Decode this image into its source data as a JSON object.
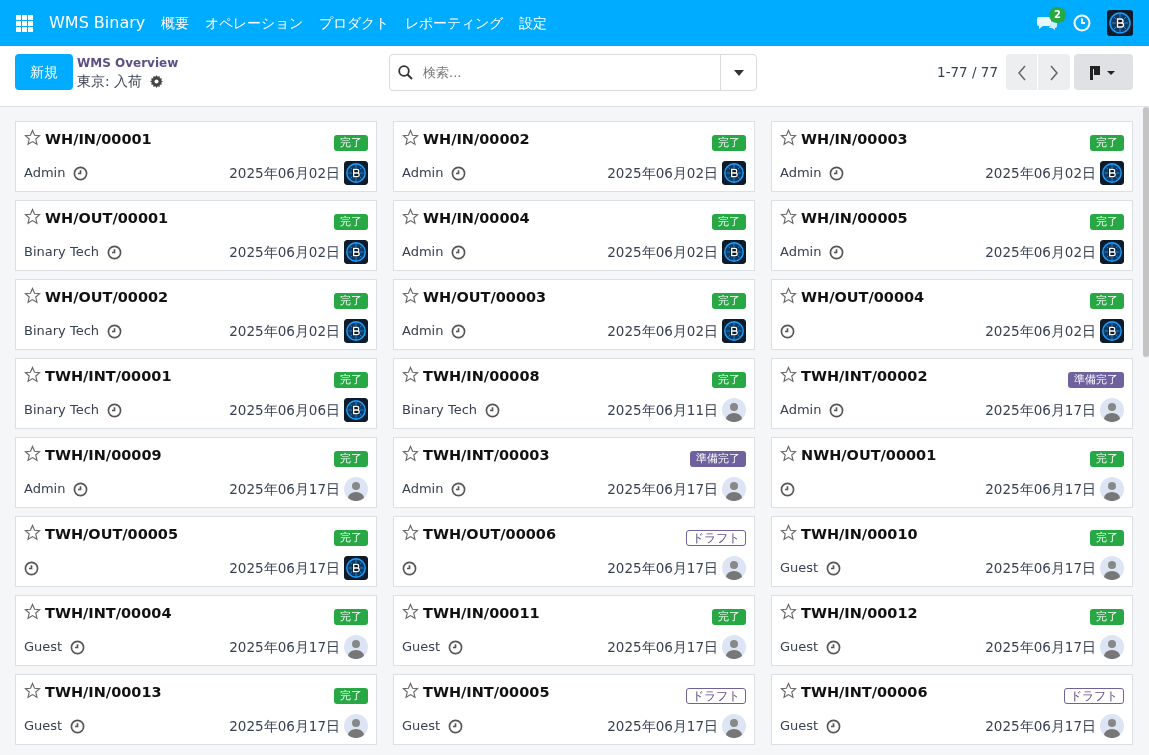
{
  "navbar": {
    "app_name": "WMS Binary",
    "menu": [
      "概要",
      "オペレーション",
      "プロダクト",
      "レポーティング",
      "設定"
    ],
    "message_count": "2"
  },
  "control_panel": {
    "new_button": "新規",
    "breadcrumb": "WMS Overview",
    "title": "東京: 入荷",
    "search": {
      "placeholder": "検索..."
    },
    "pager": "1-77 / 77"
  },
  "cards": [
    {
      "name": "WH/IN/00001",
      "status": {
        "label": "完了",
        "kind": "done"
      },
      "partner": "Admin",
      "date": "2025年06月02日",
      "avatar": {
        "kind": "logo"
      },
      "starred": false
    },
    {
      "name": "WH/IN/00002",
      "status": {
        "label": "完了",
        "kind": "done"
      },
      "partner": "Admin",
      "date": "2025年06月02日",
      "avatar": {
        "kind": "logo"
      },
      "starred": false
    },
    {
      "name": "WH/IN/00003",
      "status": {
        "label": "完了",
        "kind": "done"
      },
      "partner": "Admin",
      "date": "2025年06月02日",
      "avatar": {
        "kind": "logo"
      },
      "starred": false
    },
    {
      "name": "WH/OUT/00001",
      "status": {
        "label": "完了",
        "kind": "done"
      },
      "partner": "Binary Tech",
      "date": "2025年06月02日",
      "avatar": {
        "kind": "logo"
      },
      "starred": false
    },
    {
      "name": "WH/IN/00004",
      "status": {
        "label": "完了",
        "kind": "done"
      },
      "partner": "Admin",
      "date": "2025年06月02日",
      "avatar": {
        "kind": "logo"
      },
      "starred": false
    },
    {
      "name": "WH/IN/00005",
      "status": {
        "label": "完了",
        "kind": "done"
      },
      "partner": "Admin",
      "date": "2025年06月02日",
      "avatar": {
        "kind": "logo"
      },
      "starred": false
    },
    {
      "name": "WH/OUT/00002",
      "status": {
        "label": "完了",
        "kind": "done"
      },
      "partner": "Binary Tech",
      "date": "2025年06月02日",
      "avatar": {
        "kind": "logo"
      },
      "starred": false
    },
    {
      "name": "WH/OUT/00003",
      "status": {
        "label": "完了",
        "kind": "done"
      },
      "partner": "Admin",
      "date": "2025年06月02日",
      "avatar": {
        "kind": "logo"
      },
      "starred": false
    },
    {
      "name": "WH/OUT/00004",
      "status": {
        "label": "完了",
        "kind": "done"
      },
      "date": "2025年06月02日",
      "avatar": {
        "kind": "logo"
      },
      "starred": false
    },
    {
      "name": "TWH/INT/00001",
      "status": {
        "label": "完了",
        "kind": "done"
      },
      "partner": "Binary Tech",
      "date": "2025年06月06日",
      "avatar": {
        "kind": "logo"
      },
      "starred": false
    },
    {
      "name": "TWH/IN/00008",
      "status": {
        "label": "完了",
        "kind": "done"
      },
      "partner": "Binary Tech",
      "date": "2025年06月11日",
      "avatar": {
        "kind": "person"
      },
      "starred": false
    },
    {
      "name": "TWH/INT/00002",
      "status": {
        "label": "準備完了",
        "kind": "ready"
      },
      "partner": "Admin",
      "date": "2025年06月17日",
      "avatar": {
        "kind": "person"
      },
      "starred": false
    },
    {
      "name": "TWH/IN/00009",
      "status": {
        "label": "完了",
        "kind": "done"
      },
      "partner": "Admin",
      "date": "2025年06月17日",
      "avatar": {
        "kind": "person"
      },
      "starred": false
    },
    {
      "name": "TWH/INT/00003",
      "status": {
        "label": "準備完了",
        "kind": "ready"
      },
      "partner": "Admin",
      "date": "2025年06月17日",
      "avatar": {
        "kind": "person"
      },
      "starred": false
    },
    {
      "name": "NWH/OUT/00001",
      "status": {
        "label": "完了",
        "kind": "done"
      },
      "date": "2025年06月17日",
      "avatar": {
        "kind": "person"
      },
      "starred": false
    },
    {
      "name": "TWH/OUT/00005",
      "status": {
        "label": "完了",
        "kind": "done"
      },
      "date": "2025年06月17日",
      "avatar": {
        "kind": "logo"
      },
      "starred": false
    },
    {
      "name": "TWH/OUT/00006",
      "status": {
        "label": "ドラフト",
        "kind": "draft"
      },
      "date": "2025年06月17日",
      "avatar": {
        "kind": "person"
      },
      "starred": false
    },
    {
      "name": "TWH/IN/00010",
      "status": {
        "label": "完了",
        "kind": "done"
      },
      "partner": "Guest",
      "date": "2025年06月17日",
      "avatar": {
        "kind": "person"
      },
      "starred": false
    },
    {
      "name": "TWH/INT/00004",
      "status": {
        "label": "完了",
        "kind": "done"
      },
      "partner": "Guest",
      "date": "2025年06月17日",
      "avatar": {
        "kind": "person"
      },
      "starred": false
    },
    {
      "name": "TWH/IN/00011",
      "status": {
        "label": "完了",
        "kind": "done"
      },
      "partner": "Guest",
      "date": "2025年06月17日",
      "avatar": {
        "kind": "person"
      },
      "starred": false
    },
    {
      "name": "TWH/IN/00012",
      "status": {
        "label": "完了",
        "kind": "done"
      },
      "partner": "Guest",
      "date": "2025年06月17日",
      "avatar": {
        "kind": "person"
      },
      "starred": false
    },
    {
      "name": "TWH/IN/00013",
      "status": {
        "label": "完了",
        "kind": "done"
      },
      "partner": "Guest",
      "date": "2025年06月17日",
      "avatar": {
        "kind": "person"
      },
      "starred": false
    },
    {
      "name": "TWH/INT/00005",
      "status": {
        "label": "ドラフト",
        "kind": "draft"
      },
      "partner": "Guest",
      "date": "2025年06月17日",
      "avatar": {
        "kind": "person"
      },
      "starred": false
    },
    {
      "name": "TWH/INT/00006",
      "status": {
        "label": "ドラフト",
        "kind": "draft"
      },
      "partner": "Guest",
      "date": "2025年06月17日",
      "avatar": {
        "kind": "person"
      },
      "starred": false
    }
  ]
}
